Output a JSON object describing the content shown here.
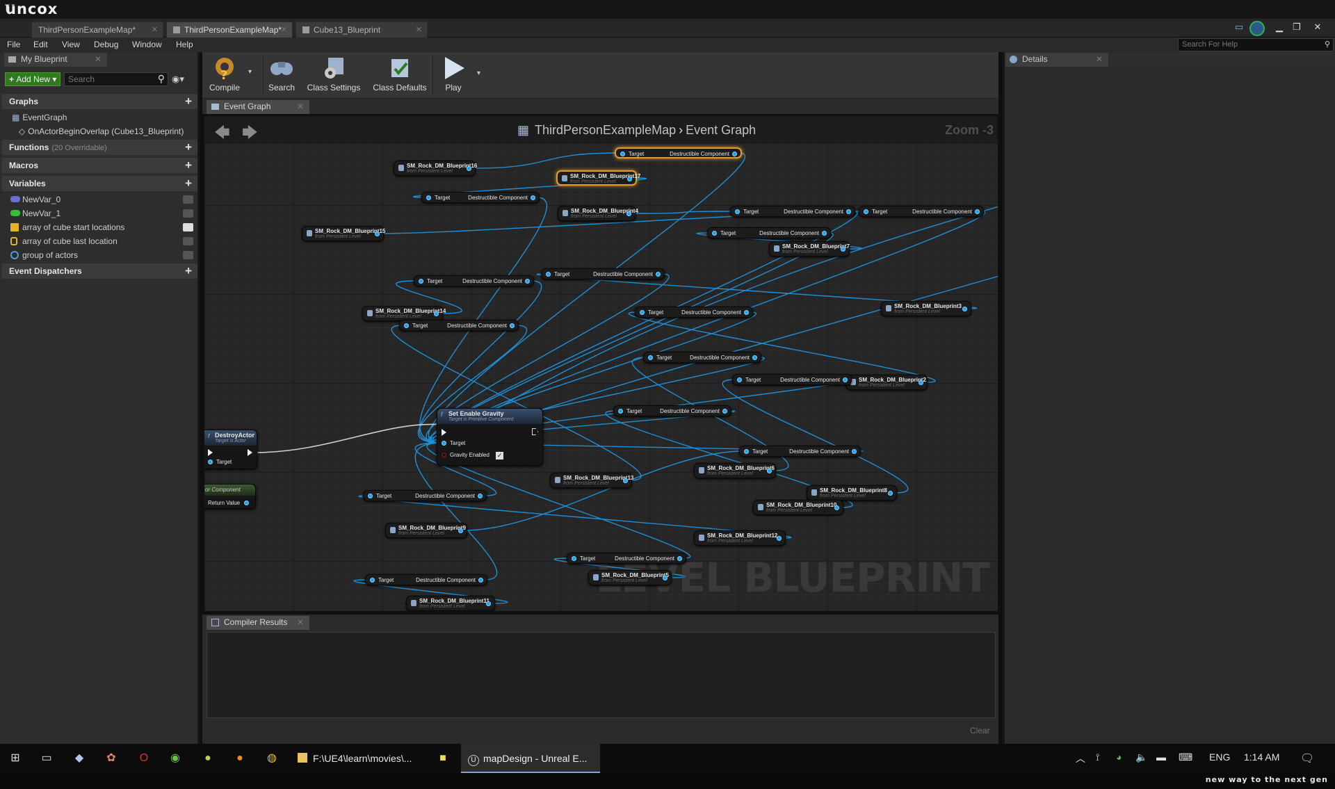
{
  "brand": "uncox",
  "tabs": [
    {
      "label": "ThirdPersonExampleMap*",
      "active": false
    },
    {
      "label": "ThirdPersonExampleMap*",
      "active": true
    },
    {
      "label": "Cube13_Blueprint",
      "active": false
    }
  ],
  "menu": [
    "File",
    "Edit",
    "View",
    "Debug",
    "Window",
    "Help"
  ],
  "help_search_placeholder": "Search For Help",
  "left": {
    "tab": "My Blueprint",
    "add_new": "Add New",
    "search_placeholder": "Search",
    "graphs_header": "Graphs",
    "event_graph": "EventGraph",
    "event_item": "OnActorBeginOverlap (Cube13_Blueprint)",
    "functions_header": "Functions",
    "functions_sub": "(20 Overridable)",
    "macros_header": "Macros",
    "variables_header": "Variables",
    "variables": [
      {
        "name": "NewVar_0",
        "color": "#6d6dd6"
      },
      {
        "name": "NewVar_1",
        "color": "#35c135"
      },
      {
        "name": "array of cube start locations",
        "color": "#e6b22b"
      },
      {
        "name": "array of cube last location",
        "color": "#e6b22b"
      },
      {
        "name": "group of actors",
        "color": "#49a0d6"
      }
    ],
    "dispatchers_header": "Event Dispatchers"
  },
  "toolbar": {
    "compile": "Compile",
    "search": "Search",
    "class_settings": "Class Settings",
    "class_defaults": "Class Defaults",
    "play": "Play"
  },
  "graph": {
    "tab": "Event Graph",
    "crumb_map": "ThirdPersonExampleMap",
    "crumb_graph": "Event Graph",
    "zoom": "Zoom -3",
    "watermark": "LEVEL BLUEPRINT",
    "ref_sub": "from Persistent Level",
    "target": "Target",
    "destructible": "Destructible Component",
    "set_gravity_title": "Set Enable Gravity",
    "set_gravity_sub": "Target is Primitive Component",
    "set_gravity_target": "Target",
    "set_gravity_enabled": "Gravity Enabled",
    "destroy_title": "DestroyActor",
    "destroy_sub": "Target is Actor",
    "destroy_target": "Target",
    "component_partial": "or Component",
    "return_value": "Return Value",
    "refs": [
      "SM_Rock_DM_Blueprint16",
      "SM_Rock_DM_Blueprint17",
      "SM_Rock_DM_Blueprint4",
      "SM_Rock_DM_Blueprint15",
      "SM_Rock_DM_Blueprint7",
      "SM_Rock_DM_Blueprint14",
      "SM_Rock_DM_Blueprint3",
      "SM_Rock_DM_Blueprint2",
      "SM_Rock_DM_Blueprint13",
      "SM_Rock_DM_Blueprint6",
      "SM_Rock_DM_Blueprint8",
      "SM_Rock_DM_Blueprint10",
      "SM_Rock_DM_Blueprint9",
      "SM_Rock_DM_Blueprint12",
      "SM_Rock_DM_Blueprint5",
      "SM_Rock_DM_Blueprint11"
    ]
  },
  "compiler": {
    "tab": "Compiler Results",
    "clear": "Clear"
  },
  "details": {
    "tab": "Details"
  },
  "taskbar": {
    "app1": "F:\\UE4\\learn\\movies\\...",
    "app2": "mapDesign - Unreal E...",
    "lang": "ENG",
    "time": "1:14 AM"
  },
  "footer": "new way to the next gen"
}
